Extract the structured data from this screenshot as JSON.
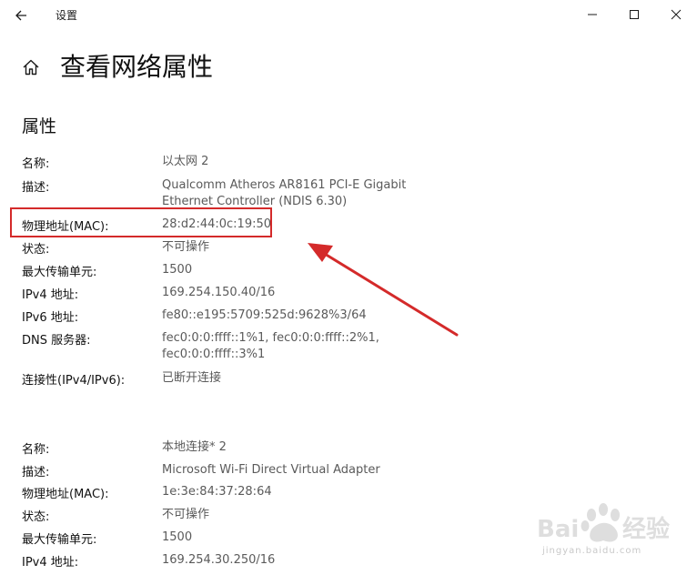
{
  "window": {
    "title": "设置",
    "back_icon": "back-arrow-icon",
    "minimize_icon": "minimize-icon",
    "maximize_icon": "maximize-icon",
    "close_icon": "close-icon"
  },
  "page": {
    "title": "查看网络属性",
    "home_icon": "home-icon"
  },
  "section": {
    "title": "属性"
  },
  "adapter1": {
    "name_label": "名称:",
    "name_value": "以太网 2",
    "desc_label": "描述:",
    "desc_value_line1": "Qualcomm Atheros AR8161 PCI-E Gigabit",
    "desc_value_line2": "Ethernet Controller (NDIS 6.30)",
    "mac_label": "物理地址(MAC):",
    "mac_value": "28:d2:44:0c:19:50",
    "status_label": "状态:",
    "status_value": "不可操作",
    "mtu_label": "最大传输单元:",
    "mtu_value": "1500",
    "ipv4_label": "IPv4 地址:",
    "ipv4_value": "169.254.150.40/16",
    "ipv6_label": "IPv6 地址:",
    "ipv6_value": "fe80::e195:5709:525d:9628%3/64",
    "dns_label": "DNS 服务器:",
    "dns_value_line1": "fec0:0:0:ffff::1%1, fec0:0:0:ffff::2%1,",
    "dns_value_line2": "fec0:0:0:ffff::3%1",
    "conn_label": "连接性(IPv4/IPv6):",
    "conn_value": "已断开连接"
  },
  "adapter2": {
    "name_label": "名称:",
    "name_value": "本地连接* 2",
    "desc_label": "描述:",
    "desc_value": "Microsoft Wi-Fi Direct Virtual Adapter",
    "mac_label": "物理地址(MAC):",
    "mac_value": "1e:3e:84:37:28:64",
    "status_label": "状态:",
    "status_value": "不可操作",
    "mtu_label": "最大传输单元:",
    "mtu_value": "1500",
    "ipv4_label": "IPv4 地址:",
    "ipv4_value": "169.254.30.250/16"
  },
  "annotation": {
    "color": "#d42a2a"
  },
  "watermark": {
    "logo_text": "Bai du 经验",
    "url_text": "jingyan.baidu.com"
  }
}
